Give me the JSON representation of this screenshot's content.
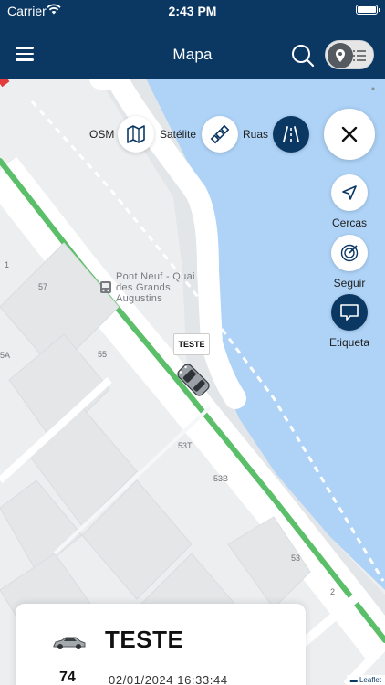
{
  "status_bar": {
    "carrier": "Carrier",
    "time": "2:43 PM"
  },
  "header": {
    "title": "Mapa"
  },
  "map": {
    "layers": [
      {
        "label": "OSM",
        "icon": "map-icon"
      },
      {
        "label": "Satélite",
        "icon": "satellite-icon"
      },
      {
        "label": "Ruas",
        "icon": "road-icon",
        "active": true
      }
    ],
    "actions": [
      {
        "label": "Cercas",
        "icon": "navigation-arrow-icon"
      },
      {
        "label": "Seguir",
        "icon": "target-icon"
      },
      {
        "label": "Etiqueta",
        "icon": "chat-bubble-icon",
        "active": true
      }
    ],
    "place_label": "Pont Neuf - Quai des Grands Augustins",
    "place_lines": [
      "Pont Neuf - Quai",
      "des Grands",
      "Augustins"
    ],
    "numbers": [
      "1",
      "57",
      "55",
      "53T",
      "53B",
      "53",
      "2",
      "5A"
    ],
    "vehicle_tag": "TESTE",
    "attribution": "Leaflet"
  },
  "vehicle_card": {
    "name": "TESTE",
    "speed": "74",
    "datetime": "02/01/2024 16:33:44"
  },
  "colors": {
    "header": "#0b3763",
    "route": "#5bbf6a",
    "water": "#aed3f7"
  }
}
